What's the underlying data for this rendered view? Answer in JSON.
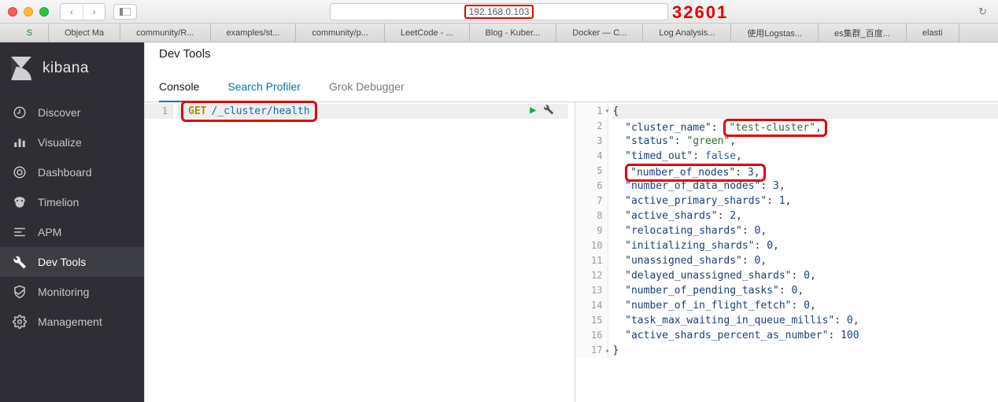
{
  "browser": {
    "address_host": "192.168.0.103",
    "address_annotation": "32601",
    "tabs": [
      "S",
      "Object Ma",
      "community/R...",
      "examples/st...",
      "community/p...",
      "LeetCode - ...",
      "Blog - Kuber...",
      "Docker — C...",
      "Log Analysis...",
      "使用Logstas...",
      "es集群_百度...",
      "elasti"
    ]
  },
  "sidebar": {
    "brand": "kibana",
    "items": [
      {
        "label": "Discover"
      },
      {
        "label": "Visualize"
      },
      {
        "label": "Dashboard"
      },
      {
        "label": "Timelion"
      },
      {
        "label": "APM"
      },
      {
        "label": "Dev Tools"
      },
      {
        "label": "Monitoring"
      },
      {
        "label": "Management"
      }
    ],
    "active_index": 5
  },
  "page": {
    "title": "Dev Tools",
    "tabs": [
      "Console",
      "Search Profiler",
      "Grok Debugger"
    ],
    "active_tab": 0
  },
  "console": {
    "request_method": "GET",
    "request_path": "/_cluster/health",
    "response_lines": [
      {
        "t": "brace",
        "v": "{"
      },
      {
        "t": "kv",
        "k": "cluster_name",
        "vt": "s",
        "v": "test-cluster",
        "c": true,
        "hl": "val"
      },
      {
        "t": "kv",
        "k": "status",
        "vt": "s",
        "v": "green",
        "c": true
      },
      {
        "t": "kv",
        "k": "timed_out",
        "vt": "b",
        "v": "false",
        "c": true
      },
      {
        "t": "kv",
        "k": "number_of_nodes",
        "vt": "n",
        "v": "3",
        "c": true,
        "hl": "row"
      },
      {
        "t": "kv",
        "k": "number_of_data_nodes",
        "vt": "n",
        "v": "3",
        "c": true
      },
      {
        "t": "kv",
        "k": "active_primary_shards",
        "vt": "n",
        "v": "1",
        "c": true
      },
      {
        "t": "kv",
        "k": "active_shards",
        "vt": "n",
        "v": "2",
        "c": true
      },
      {
        "t": "kv",
        "k": "relocating_shards",
        "vt": "n",
        "v": "0",
        "c": true
      },
      {
        "t": "kv",
        "k": "initializing_shards",
        "vt": "n",
        "v": "0",
        "c": true
      },
      {
        "t": "kv",
        "k": "unassigned_shards",
        "vt": "n",
        "v": "0",
        "c": true
      },
      {
        "t": "kv",
        "k": "delayed_unassigned_shards",
        "vt": "n",
        "v": "0",
        "c": true
      },
      {
        "t": "kv",
        "k": "number_of_pending_tasks",
        "vt": "n",
        "v": "0",
        "c": true
      },
      {
        "t": "kv",
        "k": "number_of_in_flight_fetch",
        "vt": "n",
        "v": "0",
        "c": true
      },
      {
        "t": "kv",
        "k": "task_max_waiting_in_queue_millis",
        "vt": "n",
        "v": "0",
        "c": true
      },
      {
        "t": "kv",
        "k": "active_shards_percent_as_number",
        "vt": "n",
        "v": "100",
        "c": false
      },
      {
        "t": "brace",
        "v": "}"
      }
    ]
  }
}
